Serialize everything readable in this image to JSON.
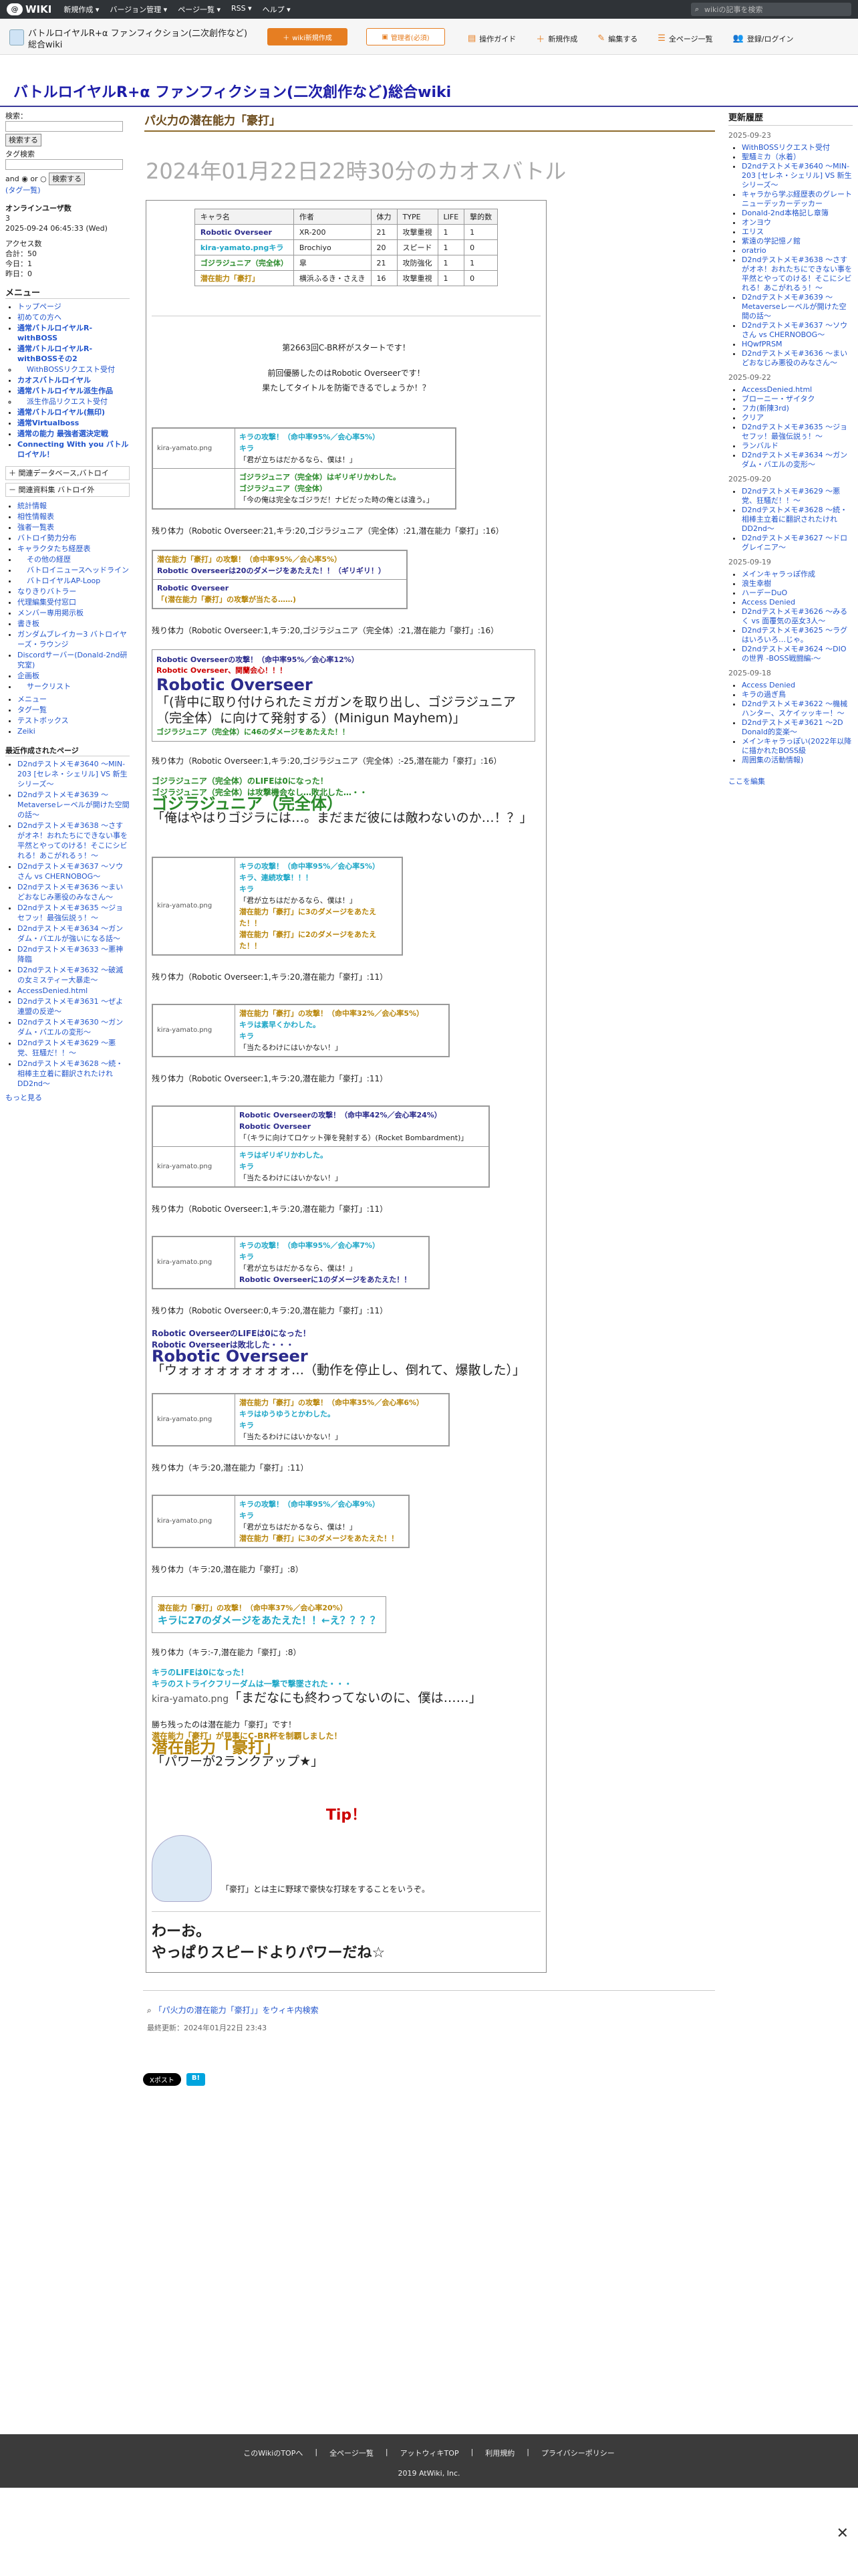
{
  "topbar": {
    "logo": "WIKI",
    "menu": [
      "新規作成 ▾",
      "バージョン管理 ▾",
      "ページ一覧 ▾",
      "RSS ▾",
      "ヘルプ ▾"
    ],
    "search_placeholder": "wikiの記事を検索"
  },
  "wikibar": {
    "title": "バトルロイヤルR+α ファンフィクション(二次創作など)総合wiki",
    "btn1": "wiki新規作成",
    "btn2": "管理者(必須)",
    "tools": [
      "操作ガイド",
      "新規作成",
      "編集する",
      "全ページ一覧",
      "登録/ログイン"
    ]
  },
  "site_title": "バトルロイヤルR+α ファンフィクション(二次創作など)総合wiki",
  "left": {
    "search_label": "検索：",
    "search_button": "検索する",
    "tag_label": "タグ検索",
    "and": "and",
    "or": "or",
    "tag_search_button": "検索する",
    "tag_link": "(タグ一覧)",
    "online_title": "オンラインユーザ数",
    "online_count": "3",
    "online_date": "2025-09-24 06:45:33 (Wed)",
    "access_title": "アクセス数",
    "access_lines": [
      "合計：50",
      "今日：1",
      "昨日：0"
    ],
    "menu_title": "メニュー",
    "menu_items": [
      "トップページ",
      "初めての方へ",
      "通常バトルロイヤルR-withBOSS",
      "通常バトルロイヤルR-withBOSSその2",
      "WithBOSSリクエスト受付",
      "カオスバトルロイヤル",
      "通常バトルロイヤル派生作品",
      "派生作品リクエスト受付",
      "通常バトルロイヤル(無印)",
      "通常Virtualboss",
      "通常の能力 最強者選決定戦",
      "Connecting With you バトルロイヤル！"
    ],
    "section2_title": "関連データベース,バトロイ",
    "section3_title": "関連資料集 バトロイ外",
    "sub_items": [
      "統計情報",
      "相性情報表",
      "強者一覧表",
      "バトロイ勢力分布",
      "キャラクタたち経歴表",
      "その他の経歴",
      "バトロイニュースヘッドライン",
      "バトロイヤルAP-Loop",
      "なりきりバトラー",
      "代理編集受付窓口",
      "メンバー専用掲示板",
      "書き板",
      "ガンダムブレイカー3 バトロイヤーズ・ラウンジ",
      "Discordサーバー(Donald-2nd研究室)",
      "企画板",
      "サークリスト"
    ],
    "extra": [
      "メニュー",
      "タグ一覧",
      "テストボックス",
      "Zeiki"
    ],
    "recent_title": "最近作成されたページ",
    "recent": [
      "D2ndテストメモ#3640 〜MIN-203 [セレネ・シェリル] VS 新生シリーズ〜",
      "D2ndテストメモ#3639 〜Metaverseレーベルが開けた空間の話〜",
      "D2ndテストメモ#3638 〜さすがオネ！おれたちにできない事を平然とやってのける！そこにシビれる！あこがれるぅ！〜",
      "D2ndテストメモ#3637 〜ソウさん vs CHERNOBOG〜",
      "D2ndテストメモ#3636 〜まいどおなじみ悪役のみなさん〜",
      "D2ndテストメモ#3635 〜ジョセフッ！最強伝説ぅ！〜",
      "D2ndテストメモ#3634 〜ガンダム・バエルが強いになる話〜",
      "D2ndテストメモ#3633 〜悪神降臨",
      "D2ndテストメモ#3632 〜破滅の女ミスティー大暴走〜",
      "AccessDenied.html",
      "D2ndテストメモ#3631 〜ぜよ連盟の反逆〜",
      "D2ndテストメモ#3630 〜ガンダム・バエルの変形〜",
      "D2ndテストメモ#3629 〜悪党、狂騒だ！！〜",
      "D2ndテストメモ#3628 〜続・相棒主立着に翻訳されたけれDD2nd〜"
    ],
    "more": "もっと見る"
  },
  "center": {
    "page_title": "パ火力の潜在能力「豪打」",
    "h1": "2024年01月22日22時30分のカオスバトル",
    "table_headers": [
      "キャラ名",
      "作者",
      "体力",
      "TYPE",
      "LIFE",
      "撃的数"
    ],
    "table_rows": [
      [
        "Robotic Overseer",
        "XR-200",
        "21",
        "攻撃重視",
        "1",
        "1"
      ],
      [
        "kira-yamato.pngキラ",
        "Brochiyo",
        "20",
        "スピード",
        "1",
        "0"
      ],
      [
        "ゴジラジュニア（完全体）",
        "皐",
        "21",
        "攻防強化",
        "1",
        "1"
      ],
      [
        "潜在能力「豪打」",
        "横浜ふるき・さえき",
        "16",
        "攻撃重視",
        "1",
        "0"
      ]
    ],
    "intro1": "第2663回C-BR杯がスタートです！",
    "intro2": "前回優勝したのはRobotic Overseerです！",
    "intro3": "果たしてタイトルを防衛できるでしょうか！？",
    "a1_img": "kira-yamato.png",
    "a1": [
      "キラの攻撃！（命中率95%／会心率5%）",
      "キラ",
      "「君が立ちはだかるなら、僕は！」",
      "ゴジラジュニア（完全体）はギリギリかわした。",
      "ゴジラジュニア（完全体）",
      "「今の俺は完全なゴジラだ！ナビだった時の俺とは違う。」"
    ],
    "hp1": "残り体力（Robotic Overseer:21,キラ:20,ゴジラジュニア（完全体）:21,潜在能力「豪打」:16）",
    "a2": [
      "潜在能力「豪打」の攻撃！（命中率95%／会心率5%）",
      "Robotic Overseerは20のダメージをあたえた！！（ギリギリ！）",
      "Robotic Overseer",
      "「(潜在能力「豪打」の攻撃が当たる……)"
    ],
    "hp2": "残り体力（Robotic Overseer:1,キラ:20,ゴジラジュニア（完全体）:21,潜在能力「豪打」:16）",
    "a3": [
      "Robotic Overseerの攻撃！（命中率95%／会心率12%）",
      "Robotic Overseer、関蘭会心！！！",
      "Robotic Overseer",
      "「(背中に取り付けられたミガガンを取り出し、ゴジラジュニア（完全体）に向けて発射する）(Minigun Mayhem)」",
      "ゴジラジュニア（完全体）に46のダメージをあたえた！！"
    ],
    "hp3": "残り体力（Robotic Overseer:1,キラ:20,ゴジラジュニア（完全体）:-25,潜在能力「豪打」:16）",
    "d1": [
      "ゴジラジュニア（完全体）のLIFEは0になった！",
      "ゴジラジュニア（完全体）は攻撃機会なし…敗北した…・・",
      "ゴジラジュニア（完全体）",
      "「俺はやはりゴジラには…。まだまだ彼には敵わないのか…！？」"
    ],
    "a4": [
      "キラの攻撃！（命中率95%／会心率5%）",
      "キラ、連続攻撃！！！",
      "キラ",
      "「君が立ちはだかるなら、僕は！」",
      "潜在能力「豪打」に3のダメージをあたえた！！",
      "潜在能力「豪打」に2のダメージをあたえた！！"
    ],
    "hp4": "残り体力（Robotic Overseer:1,キラ:20,潜在能力「豪打」:11）",
    "a5": [
      "潜在能力「豪打」の攻撃！（命中率32%／会心率5%）",
      "キラは素早くかわした。",
      "キラ",
      "「当たるわけにはいかない！」"
    ],
    "hp5": "残り体力（Robotic Overseer:1,キラ:20,潜在能力「豪打」:11）",
    "a6": [
      "Robotic Overseerの攻撃！（命中率42%／会心率24%）",
      "Robotic Overseer",
      "「（キラに向けてロケット弾を発射する）(Rocket Bombardment)」",
      "キラはギリギリかわした。",
      "キラ",
      "「当たるわけにはいかない！」"
    ],
    "hp6": "残り体力（Robotic Overseer:1,キラ:20,潜在能力「豪打」:11）",
    "a7": [
      "キラの攻撃！（命中率95%／会心率7%）",
      "キラ",
      "「君が立ちはだかるなら、僕は！」",
      "Robotic Overseerに1のダメージをあたえた！！"
    ],
    "hp7": "残り体力（Robotic Overseer:0,キラ:20,潜在能力「豪打」:11）",
    "d2": [
      "Robotic OverseerのLIFEは0になった！",
      "Robotic Overseerは敗北した・・・",
      "Robotic Overseer",
      "「ウォォォォォォォォォ…（動作を停止し、倒れて、爆散した）」"
    ],
    "a8": [
      "潜在能力「豪打」の攻撃！（命中率35%／会心率6%）",
      "キラはゆうゆうとかわした。",
      "キラ",
      "「当たるわけにはいかない！」"
    ],
    "hp8": "残り体力（キラ:20,潜在能力「豪打」:11）",
    "a9": [
      "キラの攻撃！（命中率95%／会心率9%）",
      "キラ",
      "「君が立ちはだかるなら、僕は！」",
      "潜在能力「豪打」に3のダメージをあたえた！！"
    ],
    "hp9": "残り体力（キラ:20,潜在能力「豪打」:8）",
    "a10": [
      "潜在能力「豪打」の攻撃！（命中率37%／会心率20%）",
      "キラに27のダメージをあたえた！！←え？？？？"
    ],
    "hp10": "残り体力（キラ:-7,潜在能力「豪打」:8）",
    "d3": [
      "キラのLIFEは0になった！",
      "キラのストライクフリーダムは一撃で撃墜された・・・",
      "「まだなにも終わってないのに、僕は……」"
    ],
    "win": [
      "勝ち残ったのは潜在能力「豪打」です！",
      "潜在能力「豪打」が見事にC-BR杯を制覇しました！",
      "潜在能力「豪打」",
      "「パワーが2ランクアップ★」"
    ],
    "tip": "Tip！",
    "tip_text": "「豪打」とは主に野球で豪快な打球をすることをいうぞ。",
    "end1": "わーお。",
    "end2": "やっぱりスピードよりパワーだね☆",
    "tag_search": "「パ火力の潜在能力「豪打」」をウィキ内検索",
    "last_update": "最終更新：2024年01月22日 23:43",
    "share": [
      "Xポスト",
      "B!"
    ]
  },
  "right": {
    "title": "更新履歴",
    "groups": [
      {
        "date": "2025-09-23",
        "items": [
          "WithBOSSリクエスト受付",
          "聖騒ミカ（水着）",
          "D2ndテストメモ#3640 〜MIN-203 [セレネ・シェリル] VS 新生シリーズ〜",
          "キャラから学ぶ経歴表のグレートニューデッカーデッカー",
          "Donald-2nd本格記し章簿",
          "オンヨウ",
          "エリス",
          "紫遠の学記憶ノ館",
          "oratrio",
          "D2ndテストメモ#3638 〜さすがオネ！おれたちにできない事を平然とやってのける！そこにシビれる！あこがれるぅ！〜",
          "D2ndテストメモ#3639 〜Metaverseレーベルが開けた空間の話〜",
          "D2ndテストメモ#3637 〜ソウさん vs CHERNOBOG〜",
          "HQwfPRSM",
          "D2ndテストメモ#3636 〜まいどおなじみ悪役のみなさん〜"
        ]
      },
      {
        "date": "2025-09-22",
        "items": [
          "AccessDenied.html",
          "ブローニー・ザイタク",
          "フカ(新陳3rd)",
          "クリア",
          "D2ndテストメモ#3635 〜ジョセフッ！最強伝説ぅ！〜",
          "ランバルド",
          "D2ndテストメモ#3634 〜ガンダム・バエルの変形〜"
        ]
      },
      {
        "date": "2025-09-20",
        "items": [
          "D2ndテストメモ#3629 〜悪党、狂騒だ！！〜",
          "D2ndテストメモ#3628 〜続・相棒主立着に翻訳されたけれDD2nd〜",
          "D2ndテストメモ#3627 〜ドログレイニア〜"
        ]
      },
      {
        "date": "2025-09-19",
        "items": [
          "メインキャラっぽ作成",
          "浪生幸樹",
          "ハーデーDuO",
          "Access Denied",
          "D2ndテストメモ#3626 〜みるく vs 面覆気の巫女3人〜",
          "D2ndテストメモ#3625 〜ラグはいろいろ…じゃ。",
          "D2ndテストメモ#3624 〜DIOの世界 -BOSS戦闘編-〜"
        ]
      },
      {
        "date": "2025-09-18",
        "items": [
          "Access Denied",
          "キラの過ぎ鳥",
          "D2ndテストメモ#3622 〜機械ハンター、スケイッッキー！〜",
          "D2ndテストメモ#3621 〜2D Donald的変楽〜",
          "メインキャラっぽい(2022年以降に描かれたBOSS級",
          "周囲集の活動情報)"
        ]
      }
    ],
    "edit_link": "ここを編集"
  },
  "footer": {
    "links": [
      "このWikiのTOPへ",
      "全ページ一覧",
      "アットウィキTOP",
      "利用規約",
      "プライバシーポリシー"
    ],
    "copy": "2019 AtWiki, Inc."
  },
  "colors": {
    "robotic": "#2c2c8c",
    "godzilla": "#2a8a2a",
    "kira": "#1fa7c7",
    "gouda": "#b8860b",
    "title": "#1d1da8",
    "tip": "#cc0000"
  }
}
